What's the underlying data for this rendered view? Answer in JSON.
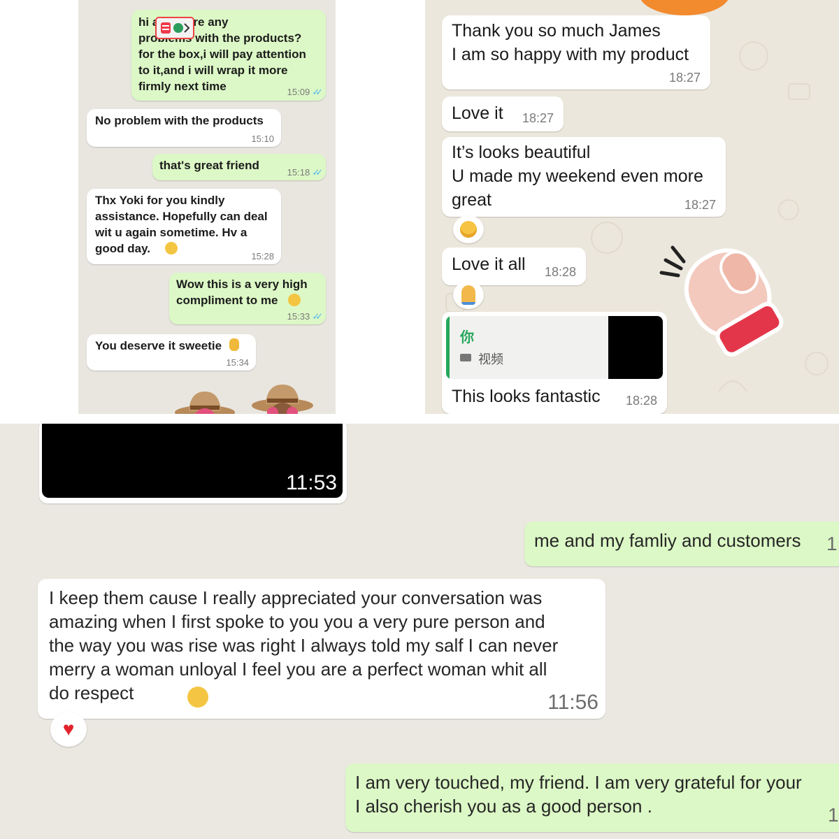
{
  "panel1": {
    "messages": [
      {
        "dir": "out",
        "text": "hi a      is there any\nproblems with the products?\nfor the box,i will pay attention\nto it,and i will wrap it more\nfirmly next time",
        "time": "15:09"
      },
      {
        "dir": "in",
        "text": "No problem with the products",
        "time": "15:10"
      },
      {
        "dir": "out",
        "text": "that's great friend",
        "time": "15:18"
      },
      {
        "dir": "in",
        "text": "Thx Yoki for you kindly\nassistance. Hopefully can deal\nwit u again sometime. Hv a\ngood day.",
        "time": "15:28"
      },
      {
        "dir": "out",
        "text": "Wow this is a very high\ncompliment to me",
        "time": "15:33"
      },
      {
        "dir": "in",
        "text": "You deserve it sweetie",
        "time": "15:34"
      }
    ],
    "colors": {
      "out": "#dcf8c6",
      "in": "#ffffff",
      "read_check": "#4fb6ec"
    }
  },
  "panel2": {
    "messages": [
      {
        "dir": "in",
        "text": "Thank you so much James\nI am so happy with my product",
        "time": "18:27"
      },
      {
        "dir": "in",
        "text": "Love it",
        "time": "18:27"
      },
      {
        "dir": "in",
        "text": "It’s looks beautiful\nU made my weekend even more\ngreat",
        "time": "18:27"
      },
      {
        "dir": "in",
        "text": "Love it all",
        "time": "18:28"
      }
    ],
    "reply": {
      "author": "你",
      "media_label": "视频",
      "text": "This looks fantastic",
      "time": "18:28"
    },
    "reactions": [
      "smiling-face",
      "folded-hands"
    ],
    "sticker": "boxing-glove-sticker"
  },
  "panel3": {
    "video_time": "11:53",
    "messages": [
      {
        "dir": "out",
        "text": "me and my famliy and customers",
        "time": "1"
      },
      {
        "dir": "in",
        "text": "I keep them cause I really appreciated your conversation was\namazing when I first spoke to you you a very pure person and\nthe way you was rise was right I always told my salf I can never\nmerry a woman  unloyal  I feel you are a perfect woman whit all\ndo respect",
        "time": "11:56"
      },
      {
        "dir": "out",
        "text": "I am very touched, my friend. I am very grateful for your\nI also cherish you as a good person .",
        "time": "1"
      }
    ],
    "reaction": "red-heart"
  }
}
